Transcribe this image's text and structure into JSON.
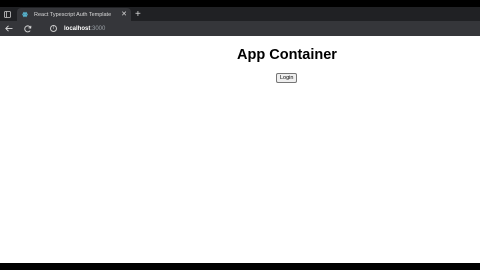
{
  "browser": {
    "tab": {
      "title": "React Typescript Auth Template",
      "close_glyph": "✕",
      "favicon": "react-atom-icon"
    },
    "new_tab_glyph": "+",
    "address": {
      "host": "localhost",
      "port": ":3000"
    }
  },
  "page": {
    "heading": "App Container",
    "login_label": "Login"
  },
  "colors": {
    "tabbar_bg": "#202124",
    "toolbar_bg": "#35363a",
    "page_bg": "#ffffff",
    "react_accent": "#61dafb"
  }
}
